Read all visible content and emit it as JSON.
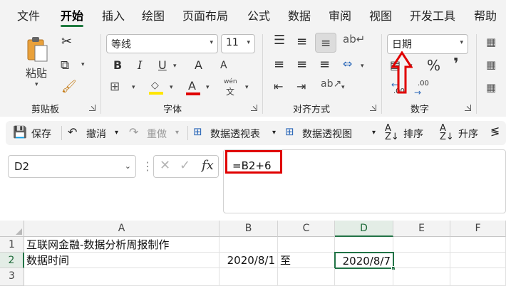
{
  "menu": {
    "items": [
      "文件",
      "开始",
      "插入",
      "绘图",
      "页面布局",
      "公式",
      "数据",
      "审阅",
      "视图",
      "开发工具",
      "帮助"
    ],
    "active": "开始"
  },
  "ribbon": {
    "clipboard": {
      "label": "剪贴板",
      "paste_label": "粘贴"
    },
    "font": {
      "label": "字体",
      "font_name": "等线",
      "font_size": "11",
      "bold": "B",
      "italic": "I",
      "underline": "U",
      "grow": "A",
      "shrink": "A",
      "font_color": "A",
      "phonetic": "wén"
    },
    "alignment": {
      "label": "对齐方式"
    },
    "number": {
      "label": "数字",
      "format": "日期",
      "percent": "%",
      "comma": "❜",
      "inc_decimal": ".00",
      "dec_decimal": ".00"
    }
  },
  "quick_access": {
    "save": "保存",
    "undo": "撤消",
    "redo": "重做",
    "pivot_table": "数据透视表",
    "pivot_chart": "数据透视图",
    "sort_desc": "排序",
    "sort_asc": "升序"
  },
  "formula_bar": {
    "name_box": "D2",
    "formula": "=B2+6",
    "cancel": "✕",
    "enter": "✓",
    "fx": "fx"
  },
  "sheet": {
    "columns": [
      "A",
      "B",
      "C",
      "D",
      "E",
      "F"
    ],
    "rows": [
      "1",
      "2",
      "3"
    ],
    "cells": {
      "A1": "互联网金融-数据分析周报制作",
      "A2": "数据时间",
      "B2": "2020/8/1",
      "C2": "至",
      "D2": "2020/8/7"
    },
    "selected_cell": "D2"
  },
  "colors": {
    "accent": "#217346",
    "annotation": "#e00000"
  }
}
